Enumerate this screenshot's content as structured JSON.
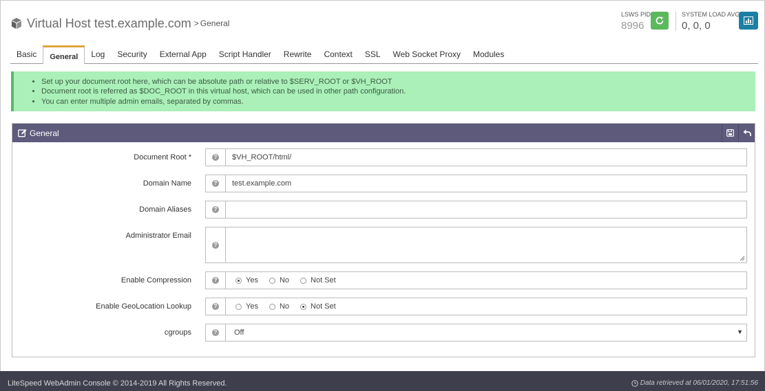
{
  "header": {
    "title": "Virtual Host test.example.com",
    "separator": ">",
    "subtitle": "General",
    "pid_label": "LSWS PID",
    "pid_value": "8996",
    "load_label": "SYSTEM LOAD AVG",
    "load_value": "0, 0, 0",
    "restart_color": "#5cb85c",
    "stats_color": "#1d7fa3"
  },
  "tabs": [
    {
      "label": "Basic",
      "active": false
    },
    {
      "label": "General",
      "active": true
    },
    {
      "label": "Log",
      "active": false
    },
    {
      "label": "Security",
      "active": false
    },
    {
      "label": "External App",
      "active": false
    },
    {
      "label": "Script Handler",
      "active": false
    },
    {
      "label": "Rewrite",
      "active": false
    },
    {
      "label": "Context",
      "active": false
    },
    {
      "label": "SSL",
      "active": false
    },
    {
      "label": "Web Socket Proxy",
      "active": false
    },
    {
      "label": "Modules",
      "active": false
    }
  ],
  "info": {
    "items": [
      "Set up your document root here, which can be absolute path or relative to $SERV_ROOT or $VH_ROOT",
      "Document root is referred as $DOC_ROOT in this virtual host, which can be used in other path configuration.",
      "You can enter multiple admin emails, separated by commas."
    ]
  },
  "panel": {
    "title": "General",
    "fields": {
      "doc_root": {
        "label": "Document Root *",
        "value": "$VH_ROOT/html/"
      },
      "domain_name": {
        "label": "Domain Name",
        "value": "test.example.com"
      },
      "domain_aliases": {
        "label": "Domain Aliases",
        "value": ""
      },
      "admin_email": {
        "label": "Administrator Email",
        "value": ""
      },
      "compression": {
        "label": "Enable Compression",
        "options": [
          "Yes",
          "No",
          "Not Set"
        ],
        "selected": "Yes"
      },
      "geolocation": {
        "label": "Enable GeoLocation Lookup",
        "options": [
          "Yes",
          "No",
          "Not Set"
        ],
        "selected": "Not Set"
      },
      "cgroups": {
        "label": "cgroups",
        "value": "Off"
      }
    }
  },
  "footer": {
    "copyright": "LiteSpeed WebAdmin Console © 2014-2019 All Rights Reserved.",
    "retrieved": "Data retrieved at 06/01/2020, 17:51:56"
  }
}
